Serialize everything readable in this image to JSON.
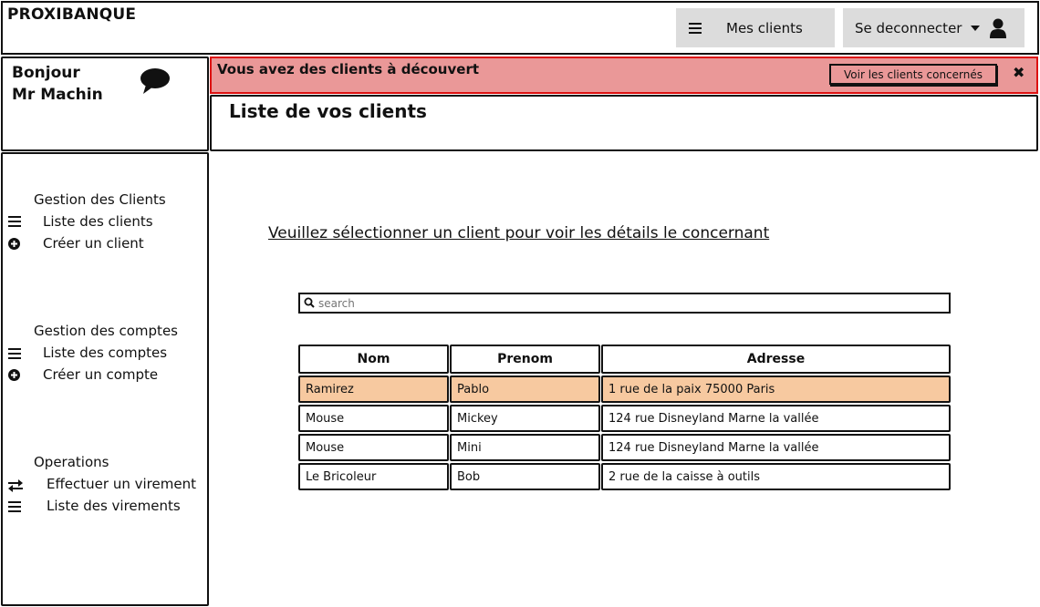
{
  "app": {
    "brand": "PROXIBANQUE"
  },
  "header": {
    "clients_label": "Mes clients",
    "logout_label": "Se deconnecter"
  },
  "sidebar": {
    "greeting_line1": "Bonjour",
    "greeting_line2": "Mr Machin",
    "sections": [
      {
        "title": "Gestion des Clients",
        "items": [
          {
            "label": "Liste des clients",
            "icon": "list-icon"
          },
          {
            "label": "Créer un client",
            "icon": "plus-circle-icon"
          }
        ]
      },
      {
        "title": "Gestion des comptes",
        "items": [
          {
            "label": "Liste des comptes",
            "icon": "list-icon"
          },
          {
            "label": "Créer un compte",
            "icon": "plus-circle-icon"
          }
        ]
      },
      {
        "title": "Operations",
        "items": [
          {
            "label": "Effectuer un virement",
            "icon": "transfer-icon"
          },
          {
            "label": "Liste des virements",
            "icon": "list-icon"
          }
        ]
      }
    ]
  },
  "alert": {
    "text": "Vous avez des clients à découvert",
    "button_label": "Voir les clients concernés",
    "close_glyph": "✖",
    "color": "#ea9898"
  },
  "main": {
    "title": "Liste de vos clients",
    "instruction": "Veuillez sélectionner un client pour voir les détails le concernant",
    "search_placeholder": "search"
  },
  "table": {
    "headers": [
      "Nom",
      "Prenom",
      "Adresse"
    ],
    "rows": [
      {
        "nom": "Ramirez",
        "prenom": "Pablo",
        "adresse": "1 rue de la paix 75000 Paris",
        "selected": true
      },
      {
        "nom": "Mouse",
        "prenom": "Mickey",
        "adresse": "124 rue Disneyland Marne la vallée",
        "selected": false
      },
      {
        "nom": "Mouse",
        "prenom": "Mini",
        "adresse": "124 rue Disneyland Marne la vallée",
        "selected": false
      },
      {
        "nom": "Le Bricoleur",
        "prenom": "Bob",
        "adresse": "2 rue de la caisse  à outils",
        "selected": false
      }
    ],
    "highlight_color": "#f7c9a0"
  }
}
